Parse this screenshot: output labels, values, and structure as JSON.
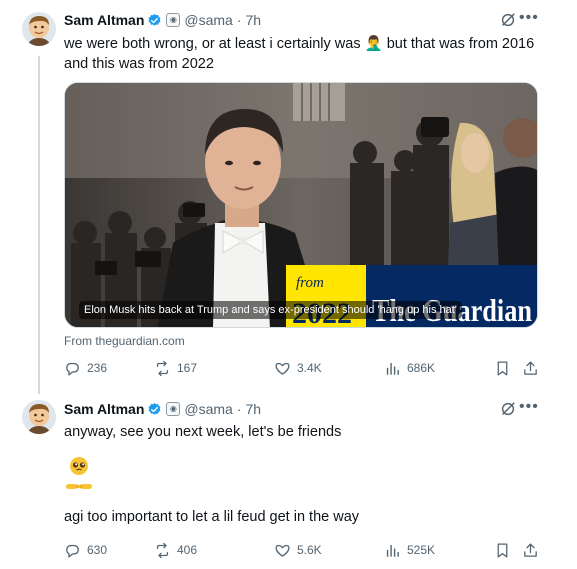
{
  "tweets": [
    {
      "author": {
        "name": "Sam Altman",
        "handle": "@sama",
        "time": "7h"
      },
      "text": "we were both wrong, or at least i certainly was 🤦‍♂️ but that was from 2016 and this was from 2022",
      "card": {
        "caption": "Elon Musk hits back at Trump and says ex-president should 'hang up his hat'",
        "source": "From theguardian.com",
        "logo_year": "2022",
        "logo_from": "from",
        "logo_brand": "The Guardian"
      },
      "stats": {
        "replies": "236",
        "reposts": "167",
        "likes": "3.4K",
        "views": "686K"
      }
    },
    {
      "author": {
        "name": "Sam Altman",
        "handle": "@sama",
        "time": "7h"
      },
      "text_line1": "anyway, see you next week, let's be friends",
      "emoji": "🥺👉👈",
      "text_line2": "agi too important to let a lil feud get in the way",
      "stats": {
        "replies": "630",
        "reposts": "406",
        "likes": "5.6K",
        "views": "525K"
      }
    }
  ],
  "separator": "·",
  "icons": [
    "verified-badge-icon",
    "affiliate-badge-icon",
    "grok-icon",
    "more-icon",
    "reply-icon",
    "repost-icon",
    "like-icon",
    "views-icon",
    "bookmark-icon",
    "share-icon"
  ],
  "colors": {
    "text": "#0f1419",
    "secondary": "#536471",
    "verified": "#1d9bf0",
    "thread_line": "#cfd9de",
    "guardian_blue": "#052962",
    "guardian_yellow": "#ffe500"
  }
}
